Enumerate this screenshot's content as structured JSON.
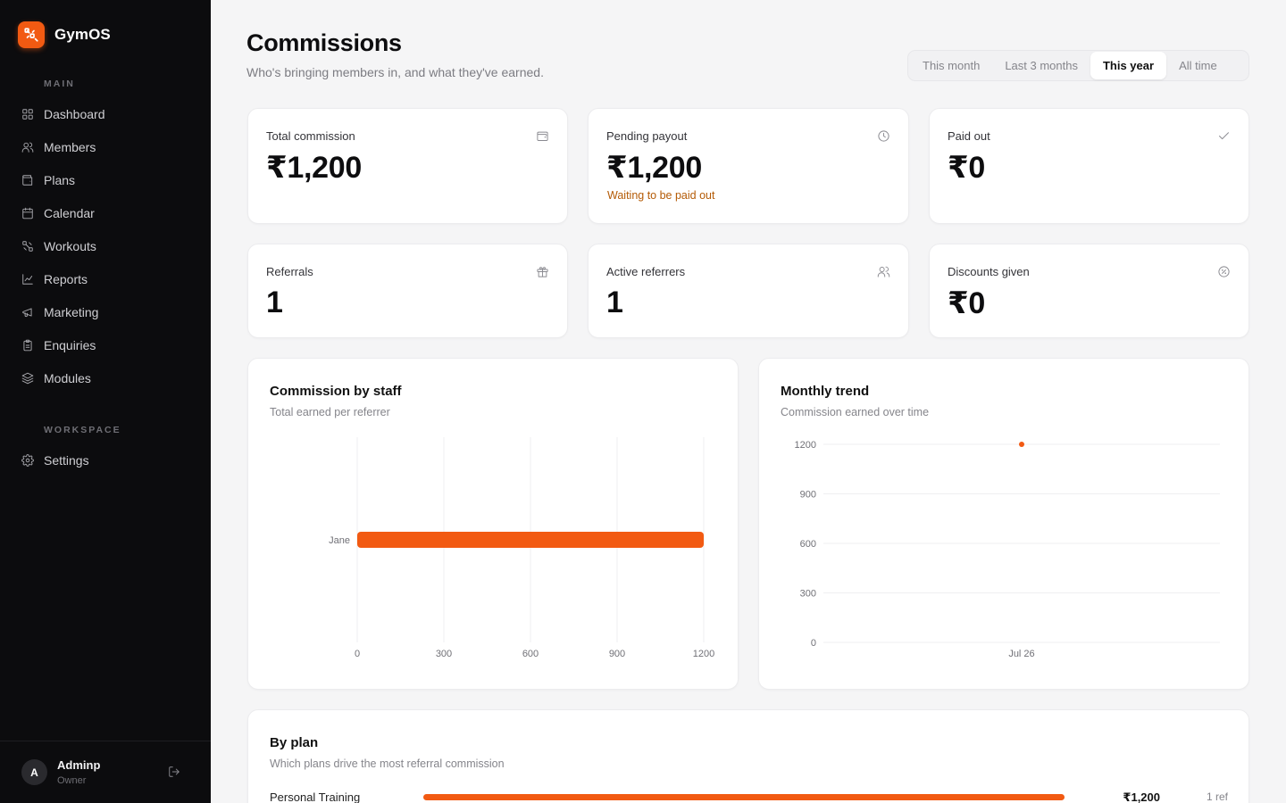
{
  "app": {
    "name": "GymOS"
  },
  "sidebar": {
    "section_main": "MAIN",
    "section_workspace": "WORKSPACE",
    "items": [
      {
        "label": "Dashboard",
        "icon": "grid-icon"
      },
      {
        "label": "Members",
        "icon": "users-icon"
      },
      {
        "label": "Plans",
        "icon": "wallet-icon"
      },
      {
        "label": "Calendar",
        "icon": "calendar-icon"
      },
      {
        "label": "Workouts",
        "icon": "dumbbell-icon"
      },
      {
        "label": "Reports",
        "icon": "chart-icon"
      },
      {
        "label": "Marketing",
        "icon": "megaphone-icon"
      },
      {
        "label": "Enquiries",
        "icon": "clipboard-icon"
      },
      {
        "label": "Modules",
        "icon": "layers-icon"
      }
    ],
    "workspace_items": [
      {
        "label": "Settings",
        "icon": "gear-icon"
      }
    ],
    "user": {
      "initial": "A",
      "name": "Adminp",
      "role": "Owner"
    }
  },
  "header": {
    "title": "Commissions",
    "subtitle": "Who's bringing members in, and what they've earned.",
    "ranges": [
      "This month",
      "Last 3 months",
      "This year",
      "All time"
    ],
    "active_range": "This year"
  },
  "stats": [
    {
      "label": "Total commission",
      "value": "₹1,200",
      "icon": "wallet-icon"
    },
    {
      "label": "Pending payout",
      "value": "₹1,200",
      "note": "Waiting to be paid out",
      "icon": "clock-icon"
    },
    {
      "label": "Paid out",
      "value": "₹0",
      "icon": "check-icon"
    },
    {
      "label": "Referrals",
      "value": "1",
      "icon": "gift-icon"
    },
    {
      "label": "Active referrers",
      "value": "1",
      "icon": "users-icon"
    },
    {
      "label": "Discounts given",
      "value": "₹0",
      "icon": "percent-icon"
    }
  ],
  "colors": {
    "accent": "#f25a12",
    "warning_text": "#b45a05",
    "sidebar_bg": "#0c0c0e"
  },
  "staff_panel": {
    "title": "Commission by staff",
    "subtitle": "Total earned per referrer"
  },
  "trend_panel": {
    "title": "Monthly trend",
    "subtitle": "Commission earned over time"
  },
  "chart_data": [
    {
      "type": "bar",
      "orientation": "horizontal",
      "categories": [
        "Jane"
      ],
      "values": [
        1200
      ],
      "xlim": [
        0,
        1200
      ],
      "x_ticks": [
        0,
        300,
        600,
        900,
        1200
      ],
      "grid": "vertical"
    },
    {
      "type": "line",
      "x": [
        "Jul 26"
      ],
      "values": [
        1200
      ],
      "ylim": [
        0,
        1200
      ],
      "y_ticks": [
        0,
        300,
        600,
        900,
        1200
      ],
      "grid": "horizontal"
    }
  ],
  "plans_panel": {
    "title": "By plan",
    "subtitle": "Which plans drive the most referral commission",
    "rows": [
      {
        "name": "Personal Training",
        "amount": "₹1,200",
        "refs": "1 ref",
        "share": 1.0
      }
    ]
  }
}
